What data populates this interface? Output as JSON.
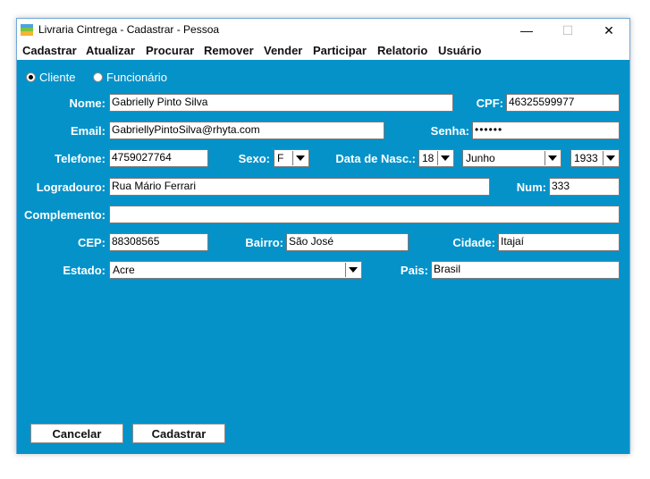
{
  "window": {
    "title": "Livraria Cintrega - Cadastrar - Pessoa",
    "minimize_glyph": "—",
    "maximize_glyph": "☐",
    "close_glyph": "✕"
  },
  "menu": [
    "Cadastrar",
    "Atualizar",
    "Procurar",
    "Remover",
    "Vender",
    "Participar",
    "Relatorio",
    "Usuário"
  ],
  "person_type": {
    "options": [
      "Cliente",
      "Funcionário"
    ],
    "selected": "Cliente"
  },
  "form": {
    "nome": {
      "label": "Nome:",
      "value": "Gabrielly Pinto Silva"
    },
    "cpf": {
      "label": "CPF:",
      "value": "46325599977"
    },
    "email": {
      "label": "Email:",
      "value": "GabriellyPintoSilva@rhyta.com"
    },
    "senha": {
      "label": "Senha:",
      "value": "••••••"
    },
    "telefone": {
      "label": "Telefone:",
      "value": "4759027764"
    },
    "sexo": {
      "label": "Sexo:",
      "value": "F"
    },
    "nascimento": {
      "label": "Data de Nasc.:",
      "day": "18",
      "month": "Junho",
      "year": "1933"
    },
    "logradouro": {
      "label": "Logradouro:",
      "value": "Rua Mário Ferrari"
    },
    "num": {
      "label": "Num:",
      "value": "333"
    },
    "complemento": {
      "label": "Complemento:",
      "value": ""
    },
    "cep": {
      "label": "CEP:",
      "value": "88308565"
    },
    "bairro": {
      "label": "Bairro:",
      "value": "São José"
    },
    "cidade": {
      "label": "Cidade:",
      "value": "Itajaí"
    },
    "estado": {
      "label": "Estado:",
      "value": "Acre"
    },
    "pais": {
      "label": "Pais:",
      "value": "Brasil"
    }
  },
  "buttons": {
    "cancel": "Cancelar",
    "submit": "Cadastrar"
  },
  "colors": {
    "background": "#0592c9",
    "label_text": "#ffffff"
  }
}
